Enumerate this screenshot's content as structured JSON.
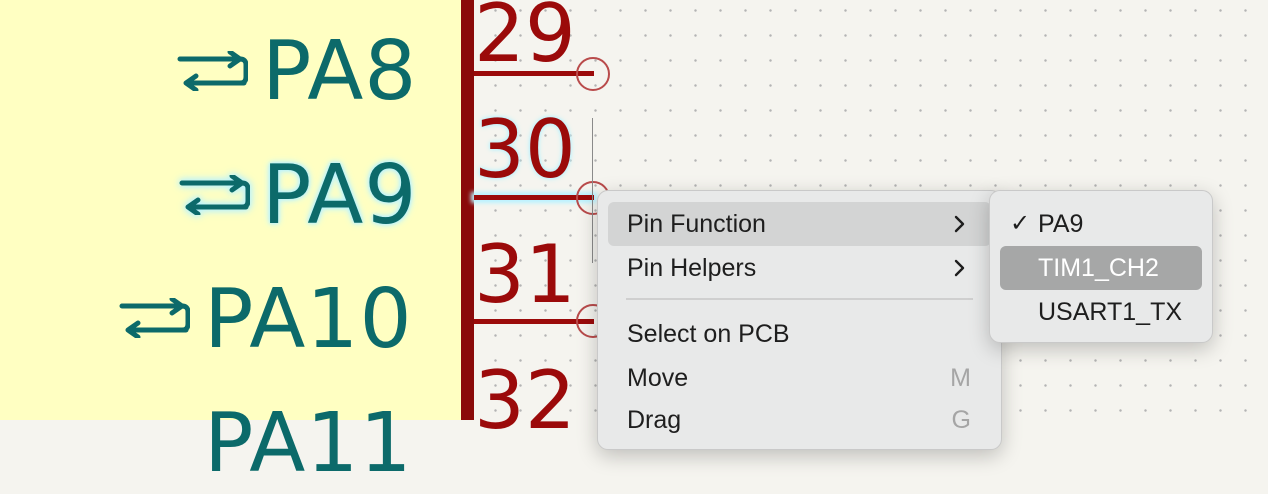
{
  "schematic": {
    "pins": [
      {
        "name": "PA8",
        "number": "29"
      },
      {
        "name": "PA9",
        "number": "30"
      },
      {
        "name": "PA10",
        "number": "31"
      },
      {
        "name": "PA11",
        "number": "32"
      }
    ],
    "highlighted_pin": "PA9",
    "colors": {
      "symbol_fill": "#ffffc2",
      "symbol_edge": "#8a0a0a",
      "pin_name": "#0c6a6a",
      "pin_number": "#9b0a0a",
      "highlight_glow": "#b8f2ff"
    }
  },
  "context_menu": {
    "items": [
      {
        "label": "Pin Function",
        "has_submenu": true,
        "active": true
      },
      {
        "label": "Pin Helpers",
        "has_submenu": true,
        "active": false
      },
      {
        "label": "Select on PCB",
        "shortcut": ""
      },
      {
        "label": "Move",
        "shortcut": "M"
      },
      {
        "label": "Drag",
        "shortcut": "G"
      }
    ],
    "chevron_icon": "chevron-right-icon"
  },
  "submenu": {
    "items": [
      {
        "label": "PA9",
        "checked": true,
        "selected": false
      },
      {
        "label": "TIM1_CH2",
        "checked": false,
        "selected": true
      },
      {
        "label": "USART1_TX",
        "checked": false,
        "selected": false
      }
    ],
    "check_mark": "✓"
  }
}
